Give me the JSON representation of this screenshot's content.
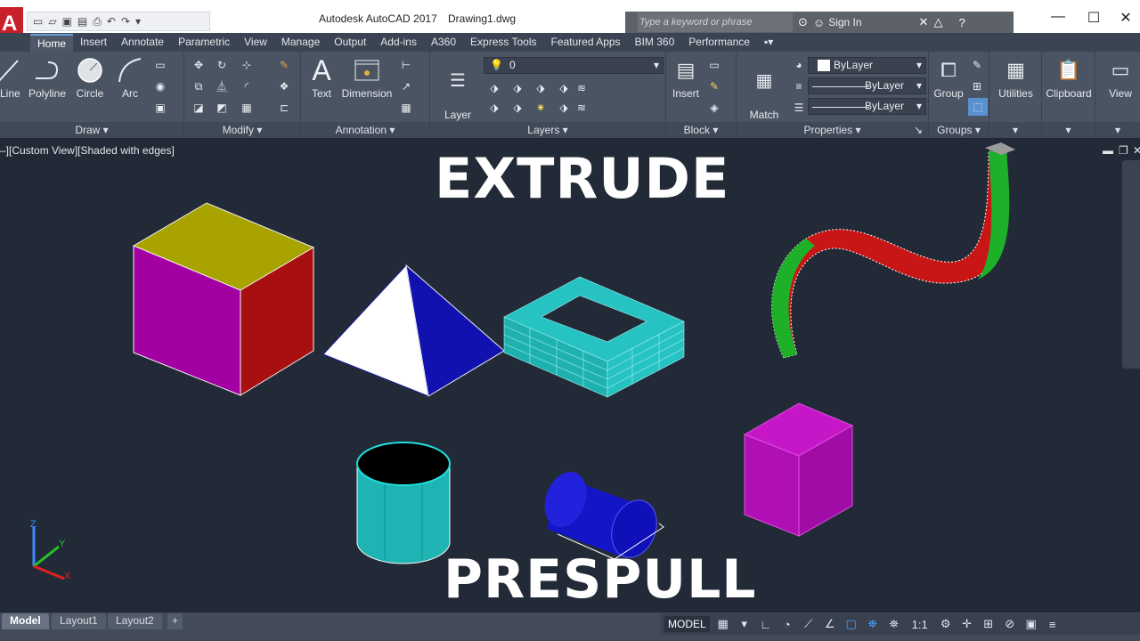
{
  "titlebar": {
    "app_letter": "A",
    "app_name": "Autodesk AutoCAD 2017",
    "document": "Drawing1.dwg",
    "search_placeholder": "Type a keyword or phrase",
    "sign_in": "Sign In",
    "help": "?"
  },
  "ribbon_tabs": [
    "Home",
    "Insert",
    "Annotate",
    "Parametric",
    "View",
    "Manage",
    "Output",
    "Add-ins",
    "A360",
    "Express Tools",
    "Featured Apps",
    "BIM 360",
    "Performance"
  ],
  "active_tab": "Home",
  "panels": {
    "draw": {
      "title": "Draw",
      "tools": [
        "Line",
        "Polyline",
        "Circle",
        "Arc"
      ]
    },
    "modify": {
      "title": "Modify"
    },
    "annotation": {
      "title": "Annotation",
      "tools": [
        "Text",
        "Dimension"
      ]
    },
    "layers": {
      "title": "Layers",
      "layer_properties": "Layer\nProperties",
      "layer_name": "0"
    },
    "block": {
      "title": "Block",
      "insert": "Insert"
    },
    "properties": {
      "title": "Properties",
      "match": "Match\nProperties",
      "color": "ByLayer",
      "linetype": "ByLayer",
      "lineweight": "ByLayer"
    },
    "groups": {
      "title": "Groups",
      "group": "Group"
    },
    "utilities": {
      "label": "Utilities"
    },
    "clipboard": {
      "label": "Clipboard"
    },
    "view": {
      "label": "View"
    }
  },
  "viewport": {
    "label": "–][Custom View][Shaded with edges]",
    "overlay_top": "EXTRUDE",
    "overlay_bottom": "PRESPULL"
  },
  "ucs": {
    "z": "Z",
    "y": "Y",
    "x": "X"
  },
  "layout_tabs": [
    "Model",
    "Layout1",
    "Layout2",
    "+"
  ],
  "active_layout": "Model",
  "statusbar": {
    "model": "MODEL",
    "scale": "1:1"
  },
  "colors": {
    "cube_top": "#a9a300",
    "cube_left": "#a300a3",
    "cube_right": "#a80f0f",
    "pyramid_light": "#ffffff",
    "pyramid_dark": "#1111b0",
    "frame": "#27c2c2",
    "cylinder": "#1fb4b4",
    "blue_cylinder": "#1515c8",
    "box": "#b00fb5",
    "sweep_green": "#1fb02a",
    "sweep_red": "#c81616"
  }
}
